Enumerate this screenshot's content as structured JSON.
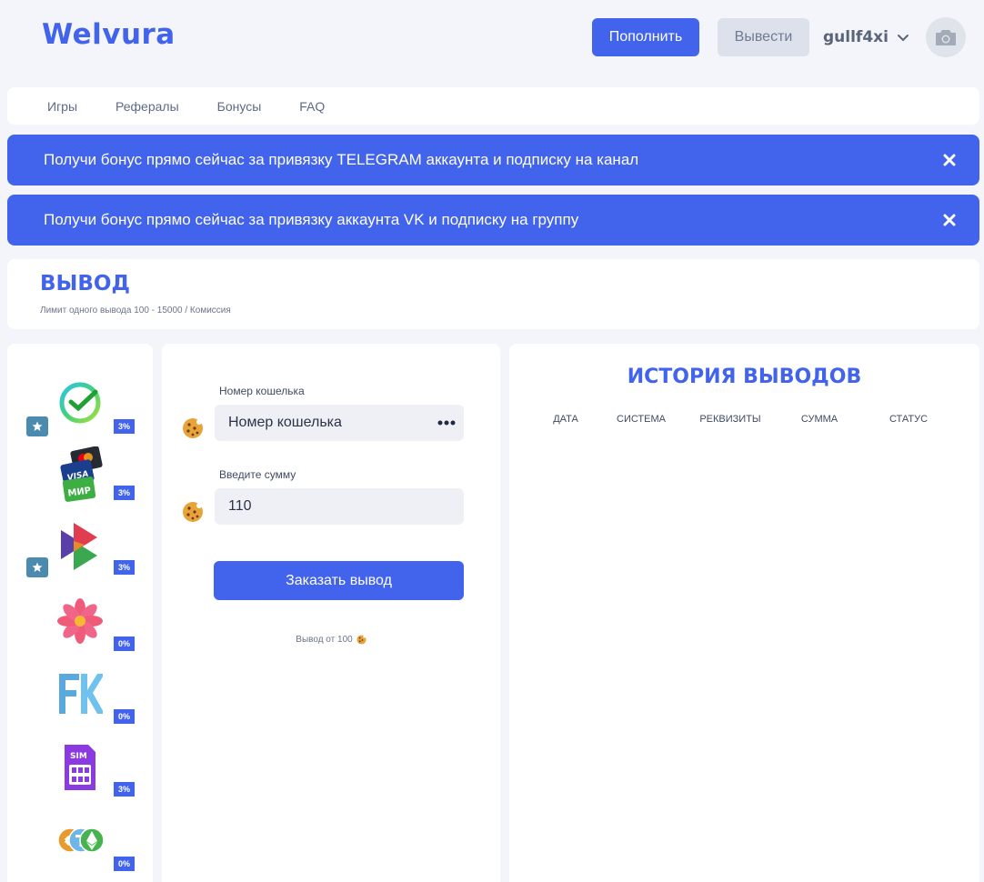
{
  "header": {
    "logo": "Welvura",
    "deposit_label": "Пополнить",
    "withdraw_label": "Вывести",
    "username": "gullf4xi"
  },
  "nav": {
    "items": [
      "Игры",
      "Рефералы",
      "Бонусы",
      "FAQ"
    ]
  },
  "banners": [
    {
      "text": "Получи бонус прямо сейчас за привязку TELEGRAM аккаунта и подписку на канал"
    },
    {
      "text": "Получи бонус прямо сейчас за привязку аккаунта VK и подписку на группу"
    }
  ],
  "page": {
    "title": "ВЫВОД",
    "subtitle": "Лимит одного вывода 100 - 15000 / Комиссия"
  },
  "methods": [
    {
      "icon": "sber-icon",
      "fee": "3%",
      "starred": true
    },
    {
      "icon": "cards-icon",
      "fee": "3%",
      "starred": false
    },
    {
      "icon": "play-icon",
      "fee": "3%",
      "starred": true
    },
    {
      "icon": "flower-icon",
      "fee": "0%",
      "starred": false
    },
    {
      "icon": "fk-icon",
      "fee": "0%",
      "starred": false
    },
    {
      "icon": "sim-icon",
      "fee": "3%",
      "starred": false
    },
    {
      "icon": "crypto-icon",
      "fee": "0%",
      "starred": false
    }
  ],
  "form": {
    "wallet_label": "Номер кошелька",
    "wallet_placeholder": "Номер кошелька",
    "amount_label": "Введите сумму",
    "amount_value": "110",
    "submit_label": "Заказать вывод",
    "note": "Вывод от 100"
  },
  "history": {
    "title": "ИСТОРИЯ ВЫВОДОВ",
    "columns": [
      "ДАТА",
      "СИСТЕМА",
      "РЕКВИЗИТЫ",
      "СУММА",
      "СТАТУС"
    ]
  },
  "colors": {
    "accent": "#4263eb",
    "background": "#f3f5fa"
  }
}
